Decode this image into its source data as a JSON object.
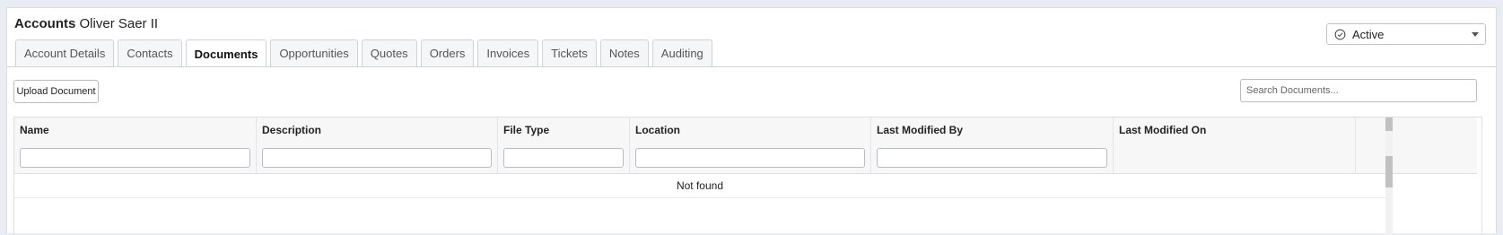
{
  "header": {
    "section": "Accounts",
    "record_name": "Oliver Saer II"
  },
  "status": {
    "value": "Active",
    "icon": "check-circle-icon"
  },
  "tabs": [
    {
      "label": "Account Details",
      "active": false
    },
    {
      "label": "Contacts",
      "active": false
    },
    {
      "label": "Documents",
      "active": true
    },
    {
      "label": "Opportunities",
      "active": false
    },
    {
      "label": "Quotes",
      "active": false
    },
    {
      "label": "Orders",
      "active": false
    },
    {
      "label": "Invoices",
      "active": false
    },
    {
      "label": "Tickets",
      "active": false
    },
    {
      "label": "Notes",
      "active": false
    },
    {
      "label": "Auditing",
      "active": false
    }
  ],
  "toolbar": {
    "upload_label": "Upload Document",
    "search_placeholder": "Search Documents..."
  },
  "table": {
    "columns": [
      "Name",
      "Description",
      "File Type",
      "Location",
      "Last Modified By",
      "Last Modified On"
    ],
    "empty_text": "Not found"
  }
}
